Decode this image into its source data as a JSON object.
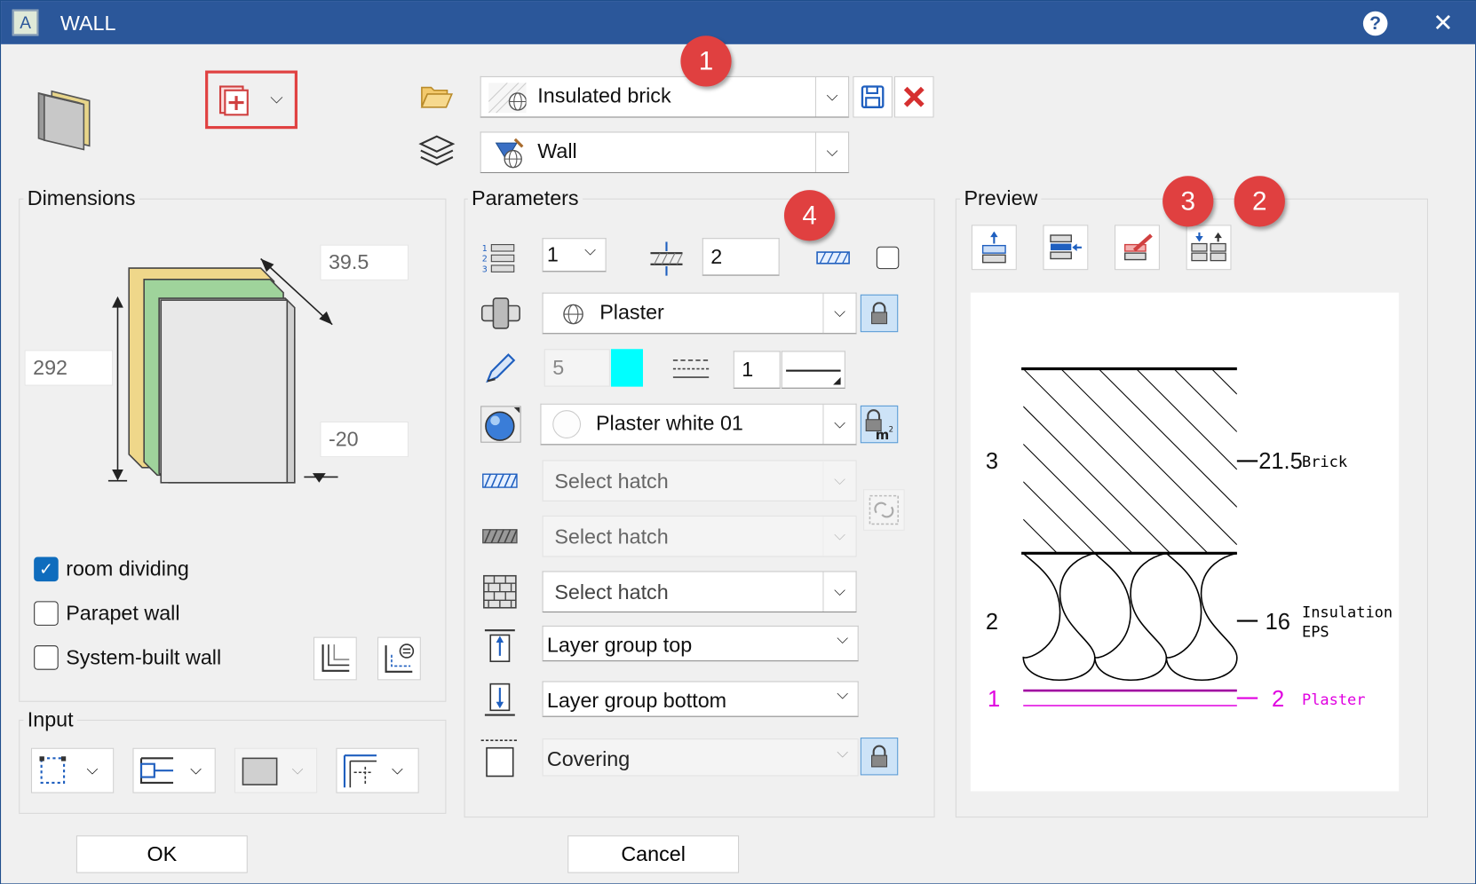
{
  "window": {
    "title": "WALL",
    "app_icon_letter": "A"
  },
  "top": {
    "material": {
      "value": "Insulated brick"
    },
    "layer": {
      "value": "Wall"
    }
  },
  "dimensions": {
    "label": "Dimensions",
    "thickness": "39.5",
    "height": "292",
    "offset": "-20",
    "checkboxes": [
      {
        "label": "room dividing",
        "checked": true
      },
      {
        "label": "Parapet wall",
        "checked": false
      },
      {
        "label": "System-built wall",
        "checked": false
      }
    ]
  },
  "input": {
    "label": "Input"
  },
  "parameters": {
    "label": "Parameters",
    "layer_number": "1",
    "layer_thickness": "2",
    "material": "Plaster",
    "pen": "5",
    "linetype": "1",
    "surface": "Plaster white 01",
    "hatch1": "Select hatch",
    "hatch2": "Select hatch",
    "hatch3": "Select hatch",
    "group_top": "Layer group top",
    "group_bottom": "Layer group bottom",
    "covering": "Covering",
    "lock_unit": "m2"
  },
  "preview": {
    "label": "Preview",
    "layers": [
      {
        "index": "3",
        "thickness": "21.5",
        "name": "Brick"
      },
      {
        "index": "2",
        "thickness": "16",
        "name": "Insulation",
        "name2": "EPS"
      },
      {
        "index": "1",
        "thickness": "2",
        "name": "Plaster"
      }
    ]
  },
  "badges": [
    "1",
    "2",
    "3",
    "4"
  ],
  "buttons": {
    "ok": "OK",
    "cancel": "Cancel"
  },
  "colors": {
    "titlebar": "#2b579a",
    "pen_color": "#00ffff",
    "highlight": "#e04040",
    "active_layer": "#e000e0"
  }
}
